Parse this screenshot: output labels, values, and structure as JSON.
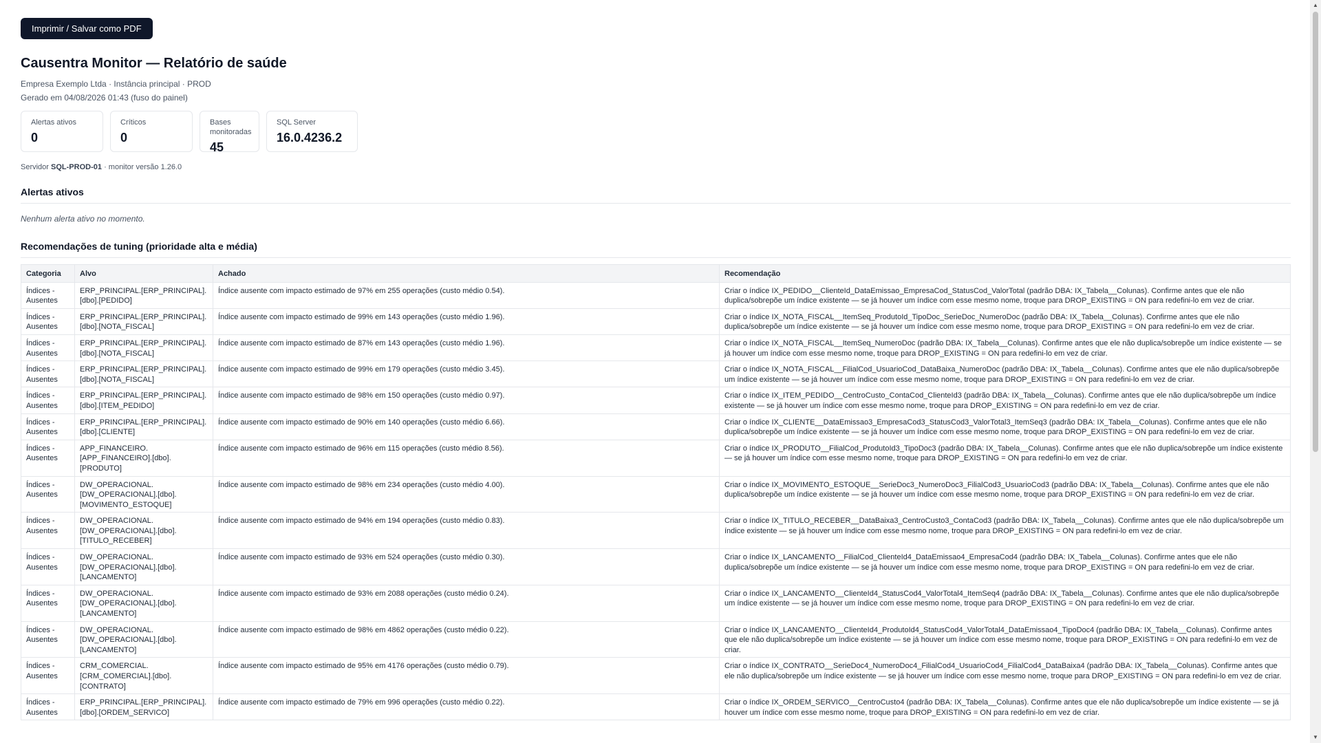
{
  "toolbar": {
    "print_label": "Imprimir / Salvar como PDF"
  },
  "report": {
    "title": "Causentra Monitor — Relatório de saúde",
    "company_line": "Empresa Exemplo Ltda · Instância principal · PROD",
    "generated_line": "Gerado em 04/08/2026 01:43 (fuso do painel)"
  },
  "cards": [
    {
      "label": "Alertas ativos",
      "value": "0"
    },
    {
      "label": "Críticos",
      "value": "0"
    },
    {
      "label": "Bases monitoradas",
      "value": "45"
    },
    {
      "label": "SQL Server",
      "value": "16.0.4236.2"
    }
  ],
  "server": {
    "prefix": "Servidor",
    "name": "SQL-PROD-01",
    "suffix": "· monitor versão 1.26.0"
  },
  "alerts": {
    "heading": "Alertas ativos",
    "empty": "Nenhum alerta ativo no momento."
  },
  "tuning": {
    "heading": "Recomendações de tuning (prioridade alta e média)",
    "columns": [
      "Categoria",
      "Alvo",
      "Achado",
      "Recomendação"
    ],
    "rows": [
      {
        "categoria": "Índices - Ausentes",
        "alvo": "ERP_PRINCIPAL.[ERP_PRINCIPAL].[dbo].[PEDIDO]",
        "achado": "Índice ausente com impacto estimado de 97% em 255 operações (custo médio 0.54).",
        "recomendacao": "Criar o índice IX_PEDIDO__ClienteId_DataEmissao_EmpresaCod_StatusCod_ValorTotal (padrão DBA: IX_Tabela__Colunas). Confirme antes que ele não duplica/sobrepõe um índice existente — se já houver um índice com esse mesmo nome, troque para DROP_EXISTING = ON para redefini-lo em vez de criar."
      },
      {
        "categoria": "Índices - Ausentes",
        "alvo": "ERP_PRINCIPAL.[ERP_PRINCIPAL].[dbo].[NOTA_FISCAL]",
        "achado": "Índice ausente com impacto estimado de 99% em 143 operações (custo médio 1.96).",
        "recomendacao": "Criar o índice IX_NOTA_FISCAL__ItemSeq_ProdutoId_TipoDoc_SerieDoc_NumeroDoc (padrão DBA: IX_Tabela__Colunas). Confirme antes que ele não duplica/sobrepõe um índice existente — se já houver um índice com esse mesmo nome, troque para DROP_EXISTING = ON para redefini-lo em vez de criar."
      },
      {
        "categoria": "Índices - Ausentes",
        "alvo": "ERP_PRINCIPAL.[ERP_PRINCIPAL].[dbo].[NOTA_FISCAL]",
        "achado": "Índice ausente com impacto estimado de 87% em 143 operações (custo médio 1.96).",
        "recomendacao": "Criar o índice IX_NOTA_FISCAL__ItemSeq_NumeroDoc (padrão DBA: IX_Tabela__Colunas). Confirme antes que ele não duplica/sobrepõe um índice existente — se já houver um índice com esse mesmo nome, troque para DROP_EXISTING = ON para redefini-lo em vez de criar."
      },
      {
        "categoria": "Índices - Ausentes",
        "alvo": "ERP_PRINCIPAL.[ERP_PRINCIPAL].[dbo].[NOTA_FISCAL]",
        "achado": "Índice ausente com impacto estimado de 99% em 179 operações (custo médio 3.45).",
        "recomendacao": "Criar o índice IX_NOTA_FISCAL__FilialCod_UsuarioCod_DataBaixa_NumeroDoc (padrão DBA: IX_Tabela__Colunas). Confirme antes que ele não duplica/sobrepõe um índice existente — se já houver um índice com esse mesmo nome, troque para DROP_EXISTING = ON para redefini-lo em vez de criar."
      },
      {
        "categoria": "Índices - Ausentes",
        "alvo": "ERP_PRINCIPAL.[ERP_PRINCIPAL].[dbo].[ITEM_PEDIDO]",
        "achado": "Índice ausente com impacto estimado de 98% em 150 operações (custo médio 0.97).",
        "recomendacao": "Criar o índice IX_ITEM_PEDIDO__CentroCusto_ContaCod_ClienteId3 (padrão DBA: IX_Tabela__Colunas). Confirme antes que ele não duplica/sobrepõe um índice existente — se já houver um índice com esse mesmo nome, troque para DROP_EXISTING = ON para redefini-lo em vez de criar."
      },
      {
        "categoria": "Índices - Ausentes",
        "alvo": "ERP_PRINCIPAL.[ERP_PRINCIPAL].[dbo].[CLIENTE]",
        "achado": "Índice ausente com impacto estimado de 90% em 140 operações (custo médio 6.66).",
        "recomendacao": "Criar o índice IX_CLIENTE__DataEmissao3_EmpresaCod3_StatusCod3_ValorTotal3_ItemSeq3 (padrão DBA: IX_Tabela__Colunas). Confirme antes que ele não duplica/sobrepõe um índice existente — se já houver um índice com esse mesmo nome, troque para DROP_EXISTING = ON para redefini-lo em vez de criar."
      },
      {
        "categoria": "Índices - Ausentes",
        "alvo": "APP_FINANCEIRO.[APP_FINANCEIRO].[dbo].[PRODUTO]",
        "achado": "Índice ausente com impacto estimado de 96% em 115 operações (custo médio 8.56).",
        "recomendacao": "Criar o índice IX_PRODUTO__FilialCod_ProdutoId3_TipoDoc3 (padrão DBA: IX_Tabela__Colunas). Confirme antes que ele não duplica/sobrepõe um índice existente — se já houver um índice com esse mesmo nome, troque para DROP_EXISTING = ON para redefini-lo em vez de criar."
      },
      {
        "categoria": "Índices - Ausentes",
        "alvo": "DW_OPERACIONAL.[DW_OPERACIONAL].[dbo].[MOVIMENTO_ESTOQUE]",
        "achado": "Índice ausente com impacto estimado de 98% em 234 operações (custo médio 4.00).",
        "recomendacao": "Criar o índice IX_MOVIMENTO_ESTOQUE__SerieDoc3_NumeroDoc3_FilialCod3_UsuarioCod3 (padrão DBA: IX_Tabela__Colunas). Confirme antes que ele não duplica/sobrepõe um índice existente — se já houver um índice com esse mesmo nome, troque para DROP_EXISTING = ON para redefini-lo em vez de criar."
      },
      {
        "categoria": "Índices - Ausentes",
        "alvo": "DW_OPERACIONAL.[DW_OPERACIONAL].[dbo].[TITULO_RECEBER]",
        "achado": "Índice ausente com impacto estimado de 94% em 194 operações (custo médio 0.83).",
        "recomendacao": "Criar o índice IX_TITULO_RECEBER__DataBaixa3_CentroCusto3_ContaCod3 (padrão DBA: IX_Tabela__Colunas). Confirme antes que ele não duplica/sobrepõe um índice existente — se já houver um índice com esse mesmo nome, troque para DROP_EXISTING = ON para redefini-lo em vez de criar."
      },
      {
        "categoria": "Índices - Ausentes",
        "alvo": "DW_OPERACIONAL.[DW_OPERACIONAL].[dbo].[LANCAMENTO]",
        "achado": "Índice ausente com impacto estimado de 93% em 524 operações (custo médio 0.30).",
        "recomendacao": "Criar o índice IX_LANCAMENTO__FilialCod_ClienteId4_DataEmissao4_EmpresaCod4 (padrão DBA: IX_Tabela__Colunas). Confirme antes que ele não duplica/sobrepõe um índice existente — se já houver um índice com esse mesmo nome, troque para DROP_EXISTING = ON para redefini-lo em vez de criar."
      },
      {
        "categoria": "Índices - Ausentes",
        "alvo": "DW_OPERACIONAL.[DW_OPERACIONAL].[dbo].[LANCAMENTO]",
        "achado": "Índice ausente com impacto estimado de 93% em 2088 operações (custo médio 0.24).",
        "recomendacao": "Criar o índice IX_LANCAMENTO__ClienteId4_StatusCod4_ValorTotal4_ItemSeq4 (padrão DBA: IX_Tabela__Colunas). Confirme antes que ele não duplica/sobrepõe um índice existente — se já houver um índice com esse mesmo nome, troque para DROP_EXISTING = ON para redefini-lo em vez de criar."
      },
      {
        "categoria": "Índices - Ausentes",
        "alvo": "DW_OPERACIONAL.[DW_OPERACIONAL].[dbo].[LANCAMENTO]",
        "achado": "Índice ausente com impacto estimado de 98% em 4862 operações (custo médio 0.22).",
        "recomendacao": "Criar o índice IX_LANCAMENTO__ClienteId4_ProdutoId4_StatusCod4_ValorTotal4_DataEmissao4_TipoDoc4 (padrão DBA: IX_Tabela__Colunas). Confirme antes que ele não duplica/sobrepõe um índice existente — se já houver um índice com esse mesmo nome, troque para DROP_EXISTING = ON para redefini-lo em vez de criar."
      },
      {
        "categoria": "Índices - Ausentes",
        "alvo": "CRM_COMERCIAL.[CRM_COMERCIAL].[dbo].[CONTRATO]",
        "achado": "Índice ausente com impacto estimado de 95% em 4176 operações (custo médio 0.79).",
        "recomendacao": "Criar o índice IX_CONTRATO__SerieDoc4_NumeroDoc4_FilialCod4_UsuarioCod4_FilialCod4_DataBaixa4 (padrão DBA: IX_Tabela__Colunas). Confirme antes que ele não duplica/sobrepõe um índice existente — se já houver um índice com esse mesmo nome, troque para DROP_EXISTING = ON para redefini-lo em vez de criar."
      },
      {
        "categoria": "Índices - Ausentes",
        "alvo": "ERP_PRINCIPAL.[ERP_PRINCIPAL].[dbo].[ORDEM_SERVICO]",
        "achado": "Índice ausente com impacto estimado de 79% em 996 operações (custo médio 0.22).",
        "recomendacao": "Criar o índice IX_ORDEM_SERVICO__CentroCusto4 (padrão DBA: IX_Tabela__Colunas). Confirme antes que ele não duplica/sobrepõe um índice existente — se já houver um índice com esse mesmo nome, troque para DROP_EXISTING = ON para redefini-lo em vez de criar."
      }
    ]
  }
}
